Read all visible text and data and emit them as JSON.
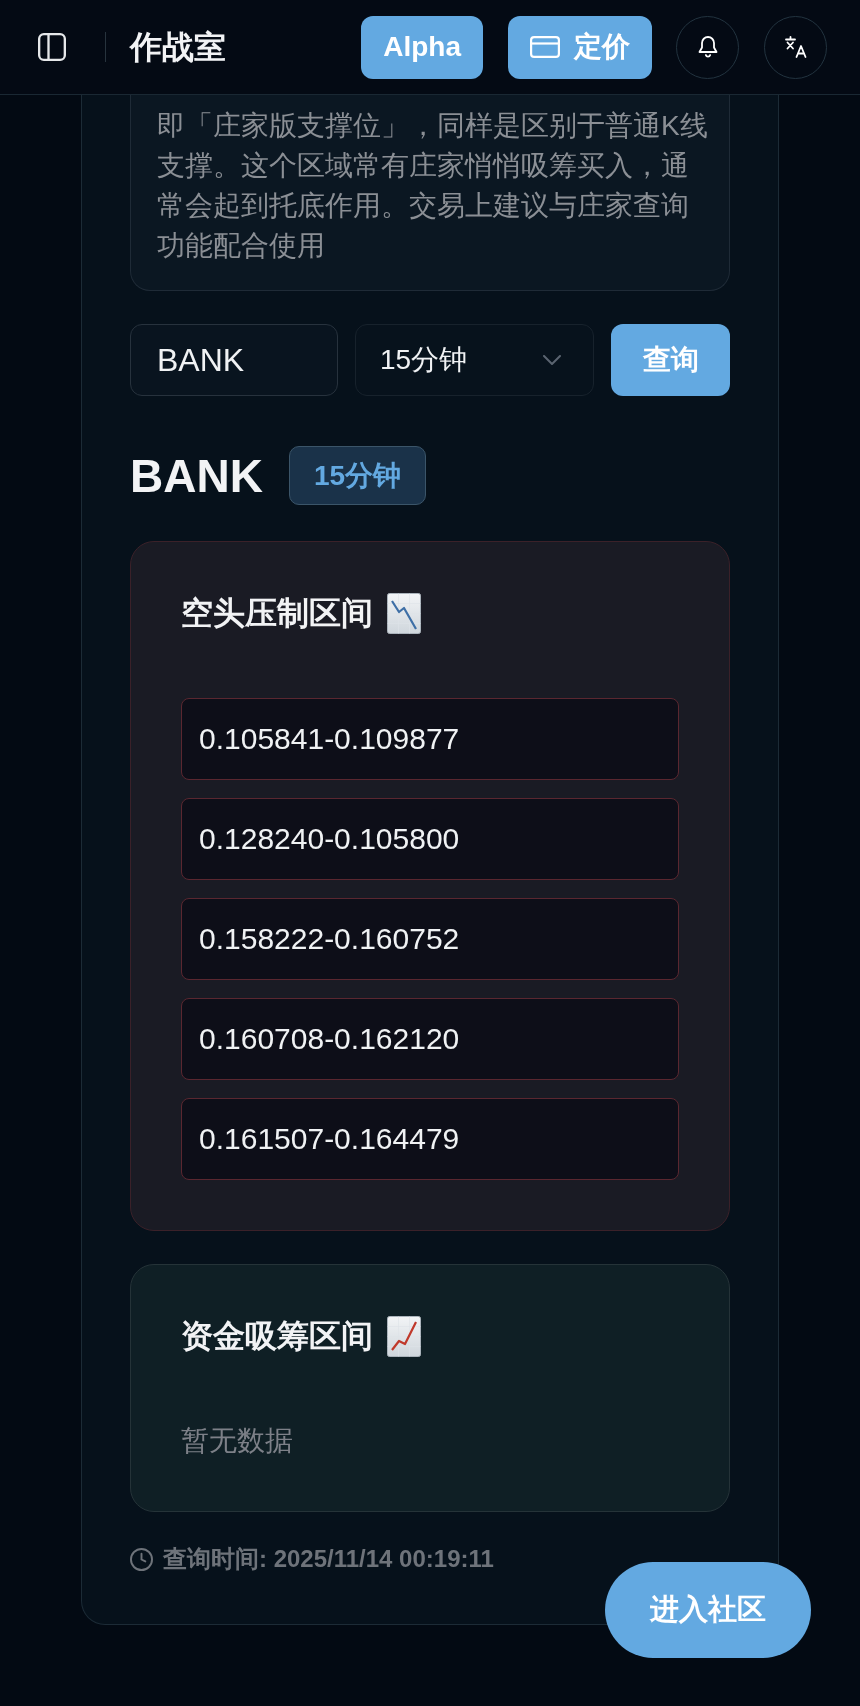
{
  "header": {
    "title": "作战室",
    "buttons": [
      {
        "kind": "plain",
        "label": "Alpha"
      },
      {
        "kind": "card",
        "label": "定价"
      }
    ]
  },
  "description": "即「庄家版支撑位」，同样是区别于普通K线支撑。这个区域常有庄家悄悄吸筹买入，通常会起到托底作用。交易上建议与庄家查询功能配合使用",
  "query": {
    "symbol": "BANK",
    "interval": "15分钟",
    "submit": "查询"
  },
  "result": {
    "symbol": "BANK",
    "interval": "15分钟"
  },
  "sections": [
    {
      "kind": "bearish",
      "title": "空头压制区间",
      "zones": [
        "0.105841-0.109877",
        "0.128240-0.105800",
        "0.158222-0.160752",
        "0.160708-0.162120",
        "0.161507-0.164479"
      ]
    },
    {
      "kind": "bullish",
      "title": "资金吸筹区间",
      "empty_text": "暂无数据"
    }
  ],
  "query_time": "查询时间: 2025/11/14 00:19:11",
  "community_button": "进入社区"
}
